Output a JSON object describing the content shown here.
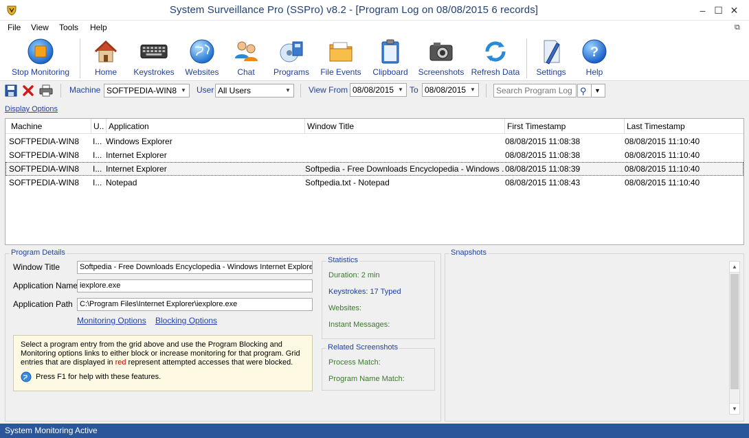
{
  "window": {
    "title": "System Surveillance Pro (SSPro) v8.2 - [Program Log on 08/08/2015  6 records]",
    "minimize": "–",
    "maximize": "☐",
    "close": "✕",
    "restore_icon": "⧉"
  },
  "menu": [
    "File",
    "View",
    "Tools",
    "Help"
  ],
  "toolbar": {
    "stop_monitoring": "Stop Monitoring",
    "home": "Home",
    "keystrokes": "Keystrokes",
    "websites": "Websites",
    "chat": "Chat",
    "programs": "Programs",
    "file_events": "File Events",
    "clipboard": "Clipboard",
    "screenshots": "Screenshots",
    "refresh_data": "Refresh Data",
    "settings": "Settings",
    "help": "Help"
  },
  "filters": {
    "machine_label": "Machine",
    "machine_value": "SOFTPEDIA-WIN8",
    "user_label": "User",
    "user_value": "All Users",
    "view_from_label": "View From",
    "from_date": "08/08/2015",
    "to_label": "To",
    "to_date": "08/08/2015",
    "search_placeholder": "Search Program Log"
  },
  "display_options": "Display Options",
  "grid": {
    "columns": [
      "Machine",
      "U..",
      "Application",
      "Window Title",
      "First Timestamp",
      "Last Timestamp"
    ],
    "rows": [
      {
        "machine": "SOFTPEDIA-WIN8",
        "user": "I...",
        "app": "Windows Explorer",
        "title": "",
        "first": "08/08/2015 11:08:38",
        "last": "08/08/2015 11:10:40"
      },
      {
        "machine": "SOFTPEDIA-WIN8",
        "user": "I...",
        "app": "Internet Explorer",
        "title": "",
        "first": "08/08/2015 11:08:38",
        "last": "08/08/2015 11:10:40"
      },
      {
        "machine": "SOFTPEDIA-WIN8",
        "user": "I...",
        "app": "Internet Explorer",
        "title": "Softpedia - Free Downloads Encyclopedia - Windows ...",
        "first": "08/08/2015 11:08:39",
        "last": "08/08/2015 11:10:40"
      },
      {
        "machine": "SOFTPEDIA-WIN8",
        "user": "I...",
        "app": "Notepad",
        "title": "Softpedia.txt - Notepad",
        "first": "08/08/2015 11:08:43",
        "last": "08/08/2015 11:10:40"
      }
    ]
  },
  "details": {
    "group_title": "Program Details",
    "window_title_label": "Window Title",
    "window_title_value": "Softpedia - Free Downloads Encyclopedia - Windows Internet Explorer",
    "app_name_label": "Application Name",
    "app_name_value": "iexplore.exe",
    "app_path_label": "Application Path",
    "app_path_value": "C:\\Program Files\\Internet Explorer\\iexplore.exe",
    "monitoring_options": "Monitoring Options",
    "blocking_options": "Blocking Options",
    "info_text_1": "Select a program entry from the grid above and use the Program Blocking and Monitoring options links to either block or increase monitoring for that program. Grid entries that are displayed in ",
    "info_red": "red",
    "info_text_2": " represent attempted accesses that were blocked.",
    "help_text": "Press F1 for help with these features."
  },
  "statistics": {
    "group_title": "Statistics",
    "duration": "Duration: 2 min",
    "keystrokes": "Keystrokes: 17 Typed",
    "websites": "Websites:",
    "instant_messages": "Instant Messages:"
  },
  "related": {
    "group_title": "Related Screenshots",
    "process_match": "Process Match:",
    "program_name_match": "Program Name Match:"
  },
  "snapshots": {
    "group_title": "Snapshots"
  },
  "status": {
    "text": "System Monitoring Active"
  },
  "colors": {
    "accent": "#2b579a",
    "link": "#1f3f9e",
    "stat_green": "#3a7a2a",
    "blocked_red": "#d00000"
  }
}
